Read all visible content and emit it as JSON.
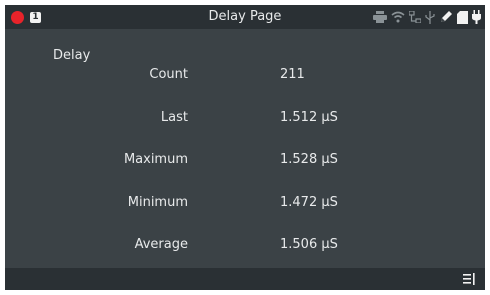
{
  "header": {
    "title": "Delay Page",
    "badge": "1"
  },
  "section": {
    "title": "Delay"
  },
  "rows": [
    {
      "label": "Count",
      "value": "211"
    },
    {
      "label": "Last",
      "value": "1.512 μS"
    },
    {
      "label": "Maximum",
      "value": "1.528 μS"
    },
    {
      "label": "Minimum",
      "value": "1.472 μS"
    },
    {
      "label": "Average",
      "value": "1.506 μS"
    }
  ],
  "status_icons": [
    "printer-icon",
    "wifi-icon",
    "network-icon",
    "usb-icon",
    "pen-icon",
    "sd-card-icon",
    "power-plug-icon"
  ],
  "colors": {
    "background": "#3b4246",
    "bar": "#2a3034",
    "text": "#e8eaeb",
    "record": "#e8232a"
  }
}
